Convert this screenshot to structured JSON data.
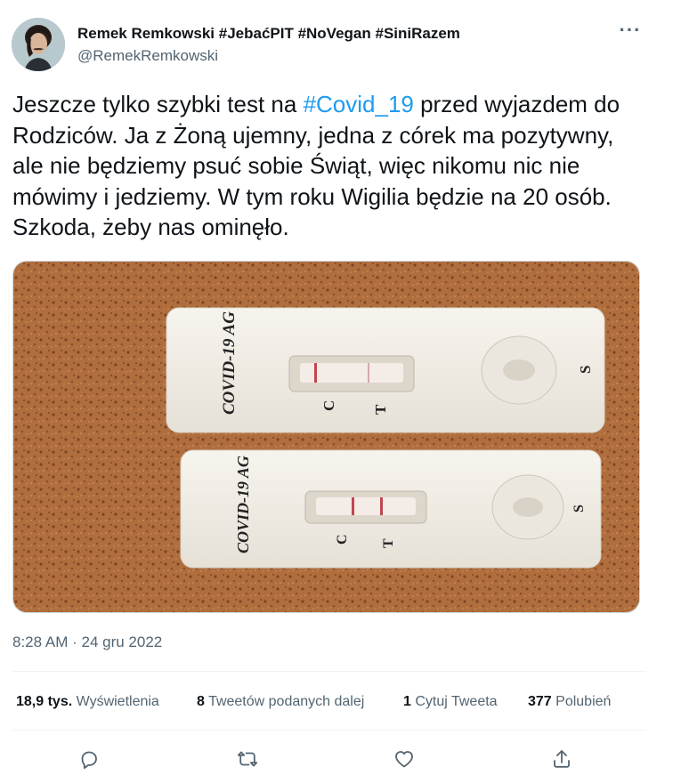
{
  "author": {
    "name": "Remek Remkowski #JebaćPIT #NoVegan #SiniRazem",
    "handle": "@RemekRemkowski"
  },
  "tweet": {
    "text_before": "Jeszcze tylko szybki test na ",
    "hashtag": "#Covid_19",
    "text_after": " przed wyjazdem do Rodziców. Ja z Żoną ujemny, jedna z córek ma pozytywny, ale nie będziemy psuć sobie Świąt, więc nikomu nic nie mówimy i jedziemy.  W tym roku Wigilia będzie na 20 osób. Szkoda, żeby nas ominęło."
  },
  "photo": {
    "test1": {
      "brand": "COVID-19 AG",
      "c": "C",
      "t": "T",
      "s": "S"
    },
    "test2": {
      "brand": "COVID-19 AG",
      "c": "C",
      "t": "T",
      "s": "S"
    }
  },
  "timestamp": {
    "time": "8:28 AM",
    "separator": " · ",
    "date": "24 gru 2022"
  },
  "stats": {
    "views_count": "18,9 tys.",
    "views_label": "Wyświetlenia",
    "retweets_count": "8",
    "retweets_label": "Tweetów podanych dalej",
    "quotes_count": "1",
    "quotes_label": "Cytuj Tweeta",
    "likes_count": "377",
    "likes_label": "Polubień"
  },
  "actions": {
    "reply_icon": "reply-icon",
    "retweet_icon": "retweet-icon",
    "like_icon": "heart-icon",
    "share_icon": "share-icon"
  },
  "colors": {
    "accent": "#1d9bf0",
    "secondary_text": "#536471",
    "primary_text": "#0f1419"
  }
}
